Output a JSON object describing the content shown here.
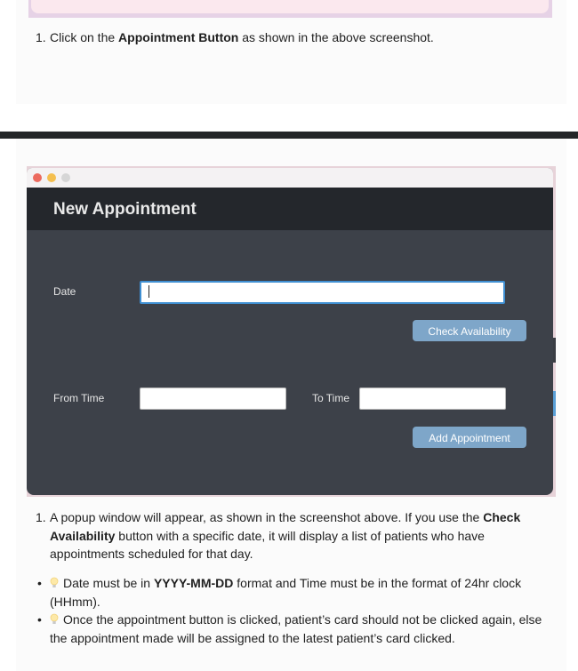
{
  "top_step": {
    "number": "1.",
    "prefix": "Click on the ",
    "bold": "Appointment Button",
    "suffix": " as shown in the above screenshot."
  },
  "window": {
    "title": "New Appointment",
    "date_label": "Date",
    "date_value": "",
    "check_button": "Check Availability",
    "from_label": "From Time",
    "from_value": "",
    "to_label": "To Time",
    "to_value": "",
    "add_button": "Add Appointment"
  },
  "second_step": {
    "number": "1.",
    "line1_prefix": "A popup window will appear, as shown in the screenshot above. If you use the ",
    "line1_bold": "Check",
    "line2_bold": "Availability",
    "line2_suffix": " button with a specific date, it will display a list of patients who have",
    "line3": "appointments scheduled for that day."
  },
  "notes": [
    {
      "icon": "lightbulb-icon",
      "prefix": "Date must be in ",
      "bold": "YYYY-MM-DD",
      "suffix": " format and Time must be in the format of 24hr clock",
      "line2": "(HHmm)."
    },
    {
      "icon": "lightbulb-icon",
      "text": "Once the appointment button is clicked, patient’s card should not be clicked again, else",
      "line2": "the appointment made will be assigned to the latest patient’s card clicked."
    }
  ],
  "colors": {
    "header": "#24272c",
    "window_body": "#3d4149",
    "button": "#7ea6c9",
    "divider": "#242628"
  }
}
